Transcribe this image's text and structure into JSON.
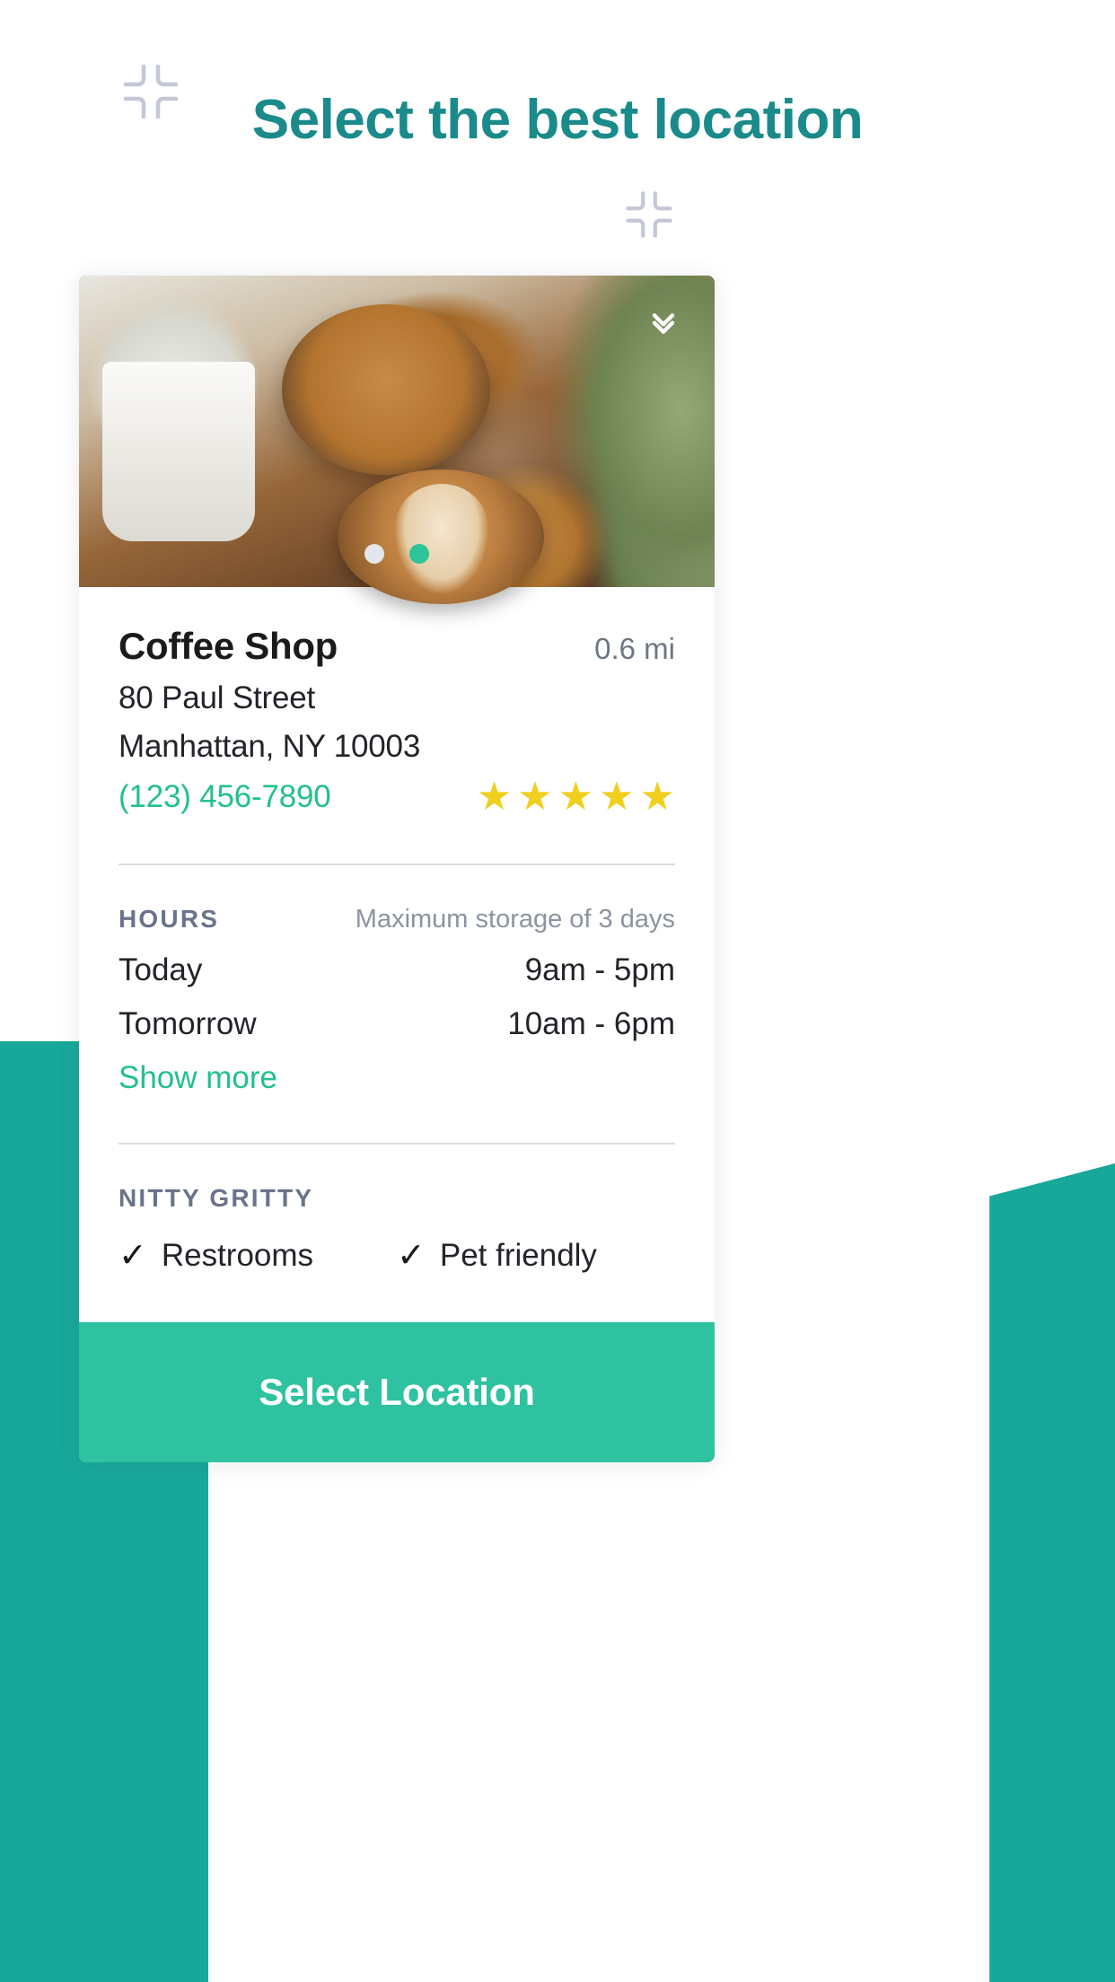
{
  "theme": {
    "title_teal": "#1a8a8a",
    "accent_green": "#23c08c",
    "cta_green": "#2ec2a0",
    "bg_block_teal": "#17a89a",
    "star_yellow": "#f0cf1e",
    "muted_gray": "#8b949f",
    "section_label_gray": "#69748a"
  },
  "header": {
    "title": "Select the best location",
    "decorations": [
      {
        "name": "expand-cross-icon-left"
      },
      {
        "name": "expand-cross-icon-right"
      }
    ]
  },
  "card": {
    "photo": {
      "alt": "Two cups of latte coffee on a wooden table with potted plants",
      "collapse_icon": "double-chevron-down-icon",
      "dots": [
        {
          "active": false
        },
        {
          "active": true
        }
      ]
    },
    "shop": {
      "name": "Coffee Shop",
      "distance": "0.6 mi",
      "address_line1": "80 Paul Street",
      "address_line2": "Manhattan, NY 10003",
      "phone": "(123) 456-7890",
      "stars": 5,
      "star_glyph": "★"
    },
    "hours": {
      "title": "HOURS",
      "note": "Maximum storage of 3 days",
      "rows": [
        {
          "day": "Today",
          "time": "9am - 5pm"
        },
        {
          "day": "Tomorrow",
          "time": "10am - 6pm"
        }
      ],
      "show_more_label": "Show more"
    },
    "nitty_gritty": {
      "title": "NITTY GRITTY",
      "check_glyph": "✓",
      "features": [
        {
          "label": "Restrooms"
        },
        {
          "label": "Pet friendly"
        }
      ]
    },
    "cta": {
      "label": "Select Location"
    }
  }
}
